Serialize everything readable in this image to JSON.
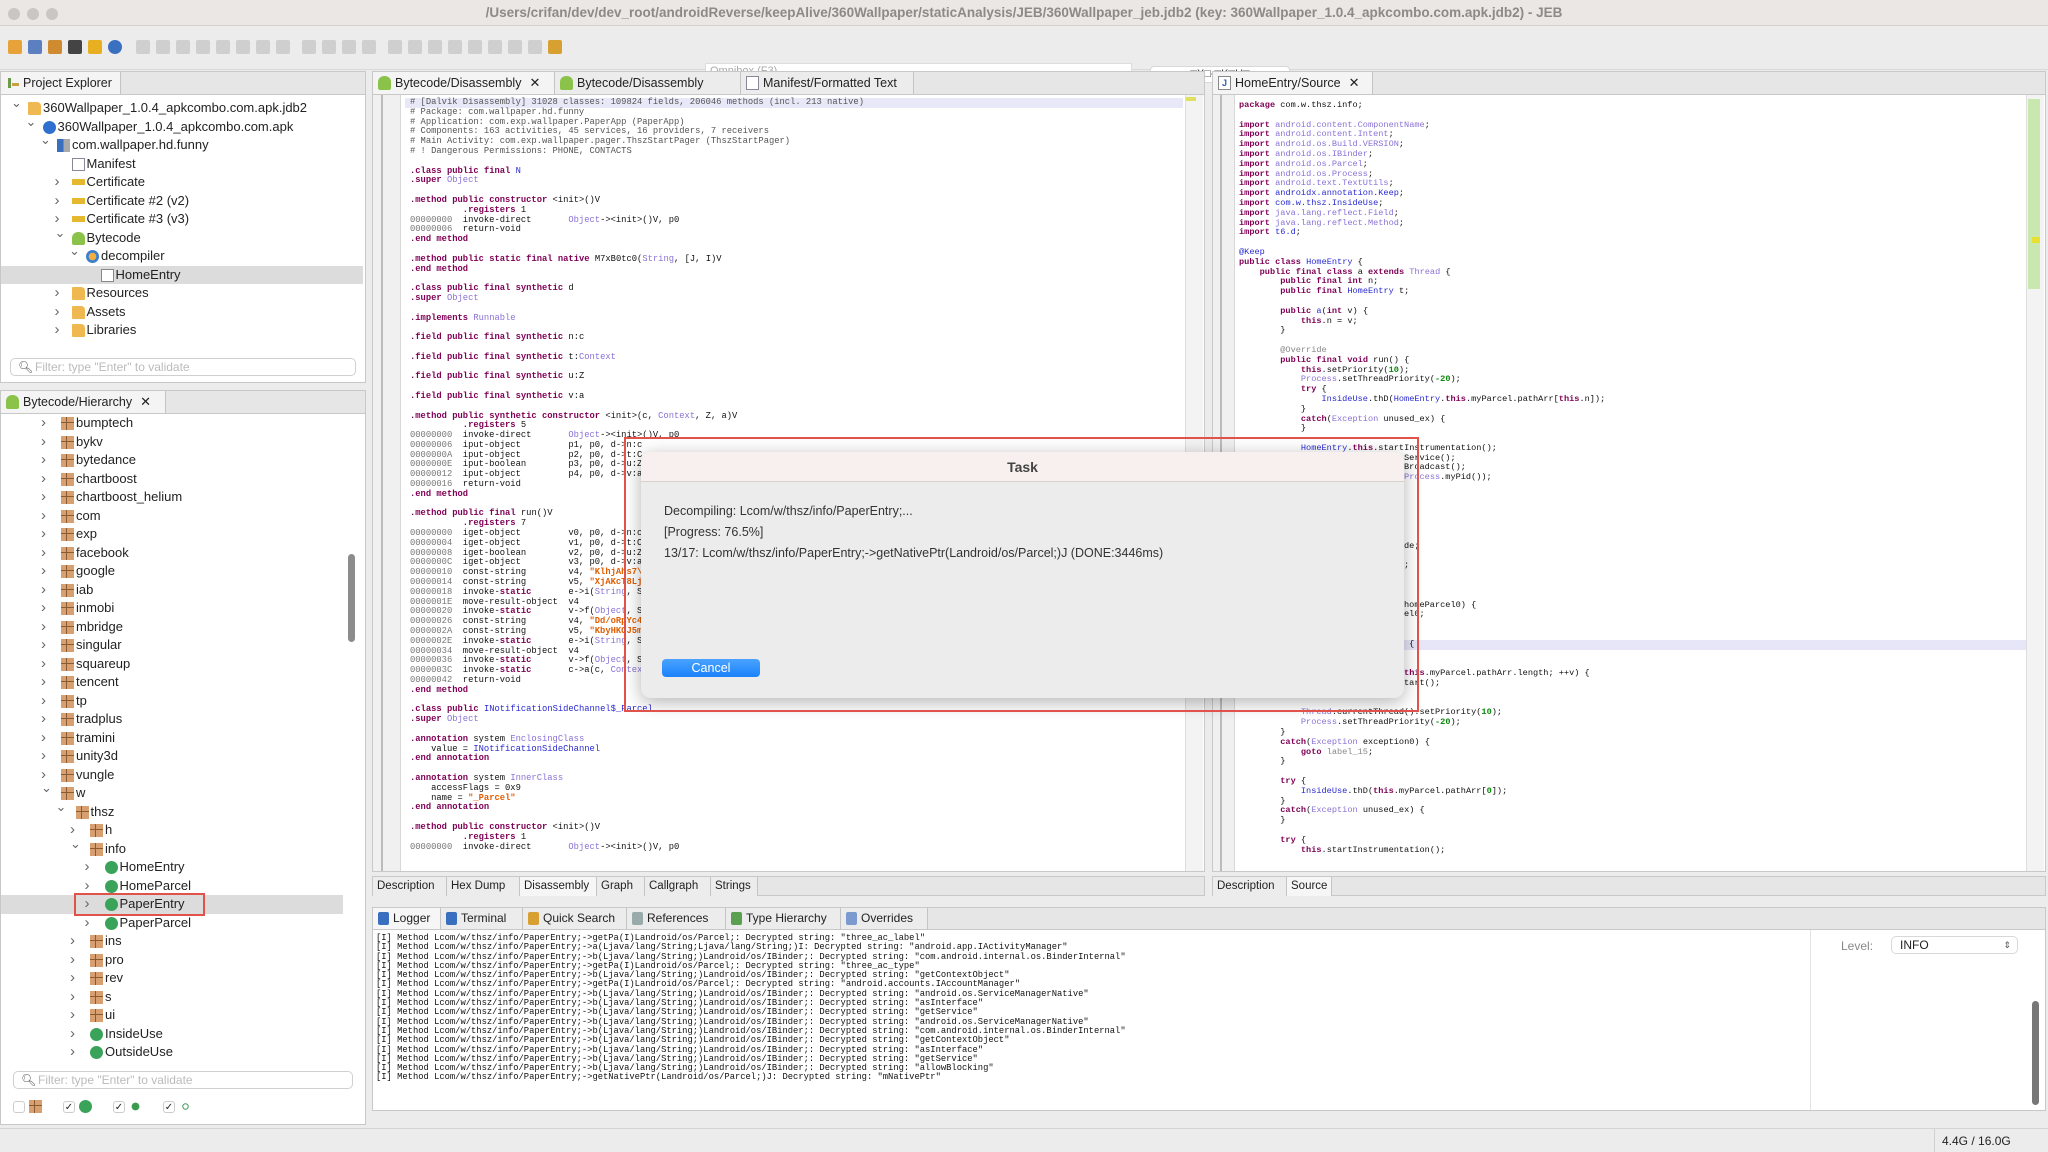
{
  "window": {
    "title": "/Users/crifan/dev/dev_root/androidReverse/keepAlive/360Wallpaper/staticAnalysis/JEB/360Wallpaper_jeb.jdb2 (key: 360Wallpaper_1.0.4_apkcombo.com.apk.jdb2) - JEB"
  },
  "toolbar": {
    "icons": [
      "open-icon",
      "save-icon",
      "wrench-icon",
      "terminal-icon",
      "warning-icon",
      "globe-icon",
      "step-icon",
      "step-into-icon",
      "back-icon",
      "forward-icon",
      "refs-icon",
      "rename-icon",
      "comment-icon",
      "xref-icon",
      "grid-icon",
      "plugin-icon",
      "split-icon",
      "merge-icon",
      "run-icon",
      "play-icon",
      "pause-icon",
      "stop-icon",
      "step-over-icon",
      "step-out-icon",
      "detach-icon",
      "attach-icon",
      "pen-icon"
    ],
    "omnibox_placeholder": "Omnibox (F3) ...",
    "key_label": "□X□-□K□U□"
  },
  "project_explorer": {
    "tab_label": "Project Explorer",
    "items": [
      {
        "label": "360Wallpaper_1.0.4_apkcombo.com.apk.jdb2",
        "depth": 0,
        "state": "open",
        "icon": "folder"
      },
      {
        "label": "360Wallpaper_1.0.4_apkcombo.com.apk",
        "depth": 1,
        "state": "open",
        "icon": "apk"
      },
      {
        "label": "com.wallpaper.hd.funny",
        "depth": 2,
        "state": "open",
        "icon": "app"
      },
      {
        "label": "Manifest",
        "depth": 3,
        "state": "leaf",
        "icon": "xml"
      },
      {
        "label": "Certificate",
        "depth": 3,
        "state": "closed",
        "icon": "key"
      },
      {
        "label": "Certificate #2 (v2)",
        "depth": 3,
        "state": "closed",
        "icon": "key"
      },
      {
        "label": "Certificate #3 (v3)",
        "depth": 3,
        "state": "closed",
        "icon": "key"
      },
      {
        "label": "Bytecode",
        "depth": 3,
        "state": "open",
        "icon": "android"
      },
      {
        "label": "decompiler",
        "depth": 4,
        "state": "open",
        "icon": "decompiler"
      },
      {
        "label": "HomeEntry",
        "depth": 5,
        "state": "leaf",
        "icon": "java",
        "selected": true
      },
      {
        "label": "Resources",
        "depth": 3,
        "state": "closed",
        "icon": "folder"
      },
      {
        "label": "Assets",
        "depth": 3,
        "state": "closed",
        "icon": "folder"
      },
      {
        "label": "Libraries",
        "depth": 3,
        "state": "closed",
        "icon": "folder"
      }
    ],
    "filter_placeholder": "Filter: type \"Enter\" to validate"
  },
  "hierarchy": {
    "tab_label": "Bytecode/Hierarchy",
    "items": [
      {
        "label": "bumptech",
        "depth": 0,
        "state": "closed",
        "icon": "pkg"
      },
      {
        "label": "bykv",
        "depth": 0,
        "state": "closed",
        "icon": "pkg"
      },
      {
        "label": "bytedance",
        "depth": 0,
        "state": "closed",
        "icon": "pkg"
      },
      {
        "label": "chartboost",
        "depth": 0,
        "state": "closed",
        "icon": "pkg"
      },
      {
        "label": "chartboost_helium",
        "depth": 0,
        "state": "closed",
        "icon": "pkg"
      },
      {
        "label": "com",
        "depth": 0,
        "state": "closed",
        "icon": "pkg"
      },
      {
        "label": "exp",
        "depth": 0,
        "state": "closed",
        "icon": "pkg"
      },
      {
        "label": "facebook",
        "depth": 0,
        "state": "closed",
        "icon": "pkg"
      },
      {
        "label": "google",
        "depth": 0,
        "state": "closed",
        "icon": "pkg"
      },
      {
        "label": "iab",
        "depth": 0,
        "state": "closed",
        "icon": "pkg"
      },
      {
        "label": "inmobi",
        "depth": 0,
        "state": "closed",
        "icon": "pkg"
      },
      {
        "label": "mbridge",
        "depth": 0,
        "state": "closed",
        "icon": "pkg"
      },
      {
        "label": "singular",
        "depth": 0,
        "state": "closed",
        "icon": "pkg"
      },
      {
        "label": "squareup",
        "depth": 0,
        "state": "closed",
        "icon": "pkg"
      },
      {
        "label": "tencent",
        "depth": 0,
        "state": "closed",
        "icon": "pkg"
      },
      {
        "label": "tp",
        "depth": 0,
        "state": "closed",
        "icon": "pkg"
      },
      {
        "label": "tradplus",
        "depth": 0,
        "state": "closed",
        "icon": "pkg"
      },
      {
        "label": "tramini",
        "depth": 0,
        "state": "closed",
        "icon": "pkg"
      },
      {
        "label": "unity3d",
        "depth": 0,
        "state": "closed",
        "icon": "pkg"
      },
      {
        "label": "vungle",
        "depth": 0,
        "state": "closed",
        "icon": "pkg"
      },
      {
        "label": "w",
        "depth": 0,
        "state": "open",
        "icon": "pkg"
      },
      {
        "label": "thsz",
        "depth": 1,
        "state": "open",
        "icon": "pkg"
      },
      {
        "label": "h",
        "depth": 2,
        "state": "closed",
        "icon": "pkg"
      },
      {
        "label": "info",
        "depth": 2,
        "state": "open",
        "icon": "pkg"
      },
      {
        "label": "HomeEntry",
        "depth": 3,
        "state": "closed",
        "icon": "class"
      },
      {
        "label": "HomeParcel",
        "depth": 3,
        "state": "closed",
        "icon": "class"
      },
      {
        "label": "PaperEntry",
        "depth": 3,
        "state": "closed",
        "icon": "class",
        "selected": true,
        "highlighted": true
      },
      {
        "label": "PaperParcel",
        "depth": 3,
        "state": "closed",
        "icon": "class"
      },
      {
        "label": "ins",
        "depth": 2,
        "state": "closed",
        "icon": "pkg"
      },
      {
        "label": "pro",
        "depth": 2,
        "state": "closed",
        "icon": "pkg"
      },
      {
        "label": "rev",
        "depth": 2,
        "state": "closed",
        "icon": "pkg"
      },
      {
        "label": "s",
        "depth": 2,
        "state": "closed",
        "icon": "pkg"
      },
      {
        "label": "ui",
        "depth": 2,
        "state": "closed",
        "icon": "pkg"
      },
      {
        "label": "InsideUse",
        "depth": 2,
        "state": "closed",
        "icon": "class"
      },
      {
        "label": "OutsideUse",
        "depth": 2,
        "state": "closed",
        "icon": "class"
      }
    ],
    "filter_placeholder": "Filter: type \"Enter\" to validate",
    "toggles": [
      {
        "icon": "package-icon",
        "checked": false
      },
      {
        "icon": "class-icon",
        "checked": true
      },
      {
        "icon": "method-icon",
        "checked": true
      },
      {
        "icon": "field-icon",
        "checked": true
      }
    ]
  },
  "editor_tabs": [
    {
      "label": "Bytecode/Disassembly",
      "icon": "android",
      "closable": true,
      "active": true
    },
    {
      "label": "Bytecode/Disassembly",
      "icon": "android",
      "closable": false
    },
    {
      "label": "Manifest/Formatted Text",
      "icon": "xml",
      "closable": false
    }
  ],
  "disassembly": {
    "lines": [
      "# [Dalvik Disassembly] 31028 classes: 109824 fields, 206046 methods (incl. 213 native)",
      "# Package: com.wallpaper.hd.funny",
      "# Application: com.exp.wallpaper.PaperApp (PaperApp)",
      "# Components: 163 activities, 45 services, 16 providers, 7 receivers",
      "# Main Activity: com.exp.wallpaper.pager.ThszStartPager (ThszStartPager)",
      "# ! Dangerous Permissions: PHONE, CONTACTS",
      "",
      ".class public final N",
      ".super Object",
      "",
      ".method public constructor <init>()V",
      "          .registers 1",
      "00000000  invoke-direct       Object-><init>()V, p0",
      "00000006  return-void",
      ".end method",
      "",
      ".method public static final native M7xB0tc0(String, [J, I)V",
      ".end method",
      "",
      ".class public final synthetic d",
      ".super Object",
      "",
      ".implements Runnable",
      "",
      ".field public final synthetic n:c",
      "",
      ".field public final synthetic t:Context",
      "",
      ".field public final synthetic u:Z",
      "",
      ".field public final synthetic v:a",
      "",
      ".method public synthetic constructor <init>(c, Context, Z, a)V",
      "          .registers 5",
      "00000000  invoke-direct       Object-><init>()V, p0",
      "00000006  iput-object         p1, p0, d->n:c",
      "0000000A  iput-object         p2, p0, d->t:C",
      "0000000E  iput-boolean        p3, p0, d->u:Z",
      "00000012  iput-object         p4, p0, d->v:a",
      "00000016  return-void",
      ".end method",
      "",
      ".method public final run()V",
      "          .registers 7",
      "00000000  iget-object         v0, p0, d->n:c",
      "00000004  iget-object         v1, p0, d->t:C",
      "00000008  iget-boolean        v2, p0, d->u:Z",
      "0000000C  iget-object         v3, p0, d->v:a",
      "00000010  const-string        v4, \"KlhjAhs7\\",
      "00000014  const-string        v5, \"XjAKcT8Lj",
      "00000018  invoke-static       e->i(String, S",
      "0000001E  move-result-object  v4",
      "00000020  invoke-static       v->f(Object, S",
      "00000026  const-string        v4, \"Dd/oRpYc4",
      "0000002A  const-string        v5, \"KbyHKOJ5m",
      "0000002E  invoke-static       e->i(String, S",
      "00000034  move-result-object  v4",
      "00000036  invoke-static       v->f(Object, S",
      "0000003C  invoke-static       c->a(c, Contex",
      "00000042  return-void",
      ".end method",
      "",
      ".class public INotificationSideChannel$_Parcel",
      ".super Object",
      "",
      ".annotation system EnclosingClass",
      "    value = INotificationSideChannel",
      ".end annotation",
      "",
      ".annotation system InnerClass",
      "    accessFlags = 0x9",
      "    name = \"_Parcel\"",
      ".end annotation",
      "",
      ".method public constructor <init>()V",
      "          .registers 1",
      "00000000  invoke-direct       Object-><init>()V, p0"
    ],
    "bottom_tabs": [
      "Description",
      "Hex Dump",
      "Disassembly",
      "Graph",
      "Callgraph",
      "Strings"
    ],
    "active_bottom_tab": 2
  },
  "source": {
    "tab_label": "HomeEntry/Source",
    "lines": [
      "package com.w.thsz.info;",
      "",
      "import android.content.ComponentName;",
      "import android.content.Intent;",
      "import android.os.Build.VERSION;",
      "import android.os.IBinder;",
      "import android.os.Parcel;",
      "import android.os.Process;",
      "import android.text.TextUtils;",
      "import androidx.annotation.Keep;",
      "import com.w.thsz.InsideUse;",
      "import java.lang.reflect.Field;",
      "import java.lang.reflect.Method;",
      "import t6.d;",
      "",
      "@Keep",
      "public class HomeEntry {",
      "    public final class a extends Thread {",
      "        public final int n;",
      "        public final HomeEntry t;",
      "",
      "        public a(int v) {",
      "            this.n = v;",
      "        }",
      "",
      "        @Override",
      "        public final void run() {",
      "            this.setPriority(10);",
      "            Process.setThreadPriority(-20);",
      "            try {",
      "                InsideUse.thD(HomeEntry.this.myParcel.pathArr[this.n]);",
      "            }",
      "            catch(Exception unused_ex) {",
      "            }",
      "",
      "            HomeEntry.this.startInstrumentation();",
      "                                Service();",
      "                                Broadcast();",
      "                                Process.myPid());",
      "",
      "",
      "",
      "",
      "",
      "",
      "                                de;",
      "",
      "                                ;",
      "",
      "",
      "",
      "                                homeParcel0) {",
      "                                el0;",
      "",
      "",
      "                                 {",
      "",
      "",
      "                                this.myParcel.pathArr.length; ++v) {",
      "                                tart();",
      "",
      "",
      "            Thread.currentThread().setPriority(10);",
      "            Process.setThreadPriority(-20);",
      "        }",
      "        catch(Exception exception0) {",
      "            goto label_15;",
      "        }",
      "",
      "        try {",
      "            InsideUse.thD(this.myParcel.pathArr[0]);",
      "        }",
      "        catch(Exception unused_ex) {",
      "        }",
      "",
      "        try {",
      "            this.startInstrumentation();"
    ],
    "highlight_line": 55,
    "bottom_tabs": [
      "Description",
      "Source"
    ],
    "active_bottom_tab": 1
  },
  "console": {
    "tabs": [
      {
        "label": "Logger",
        "icon": "logger",
        "active": true
      },
      {
        "label": "Terminal",
        "icon": "terminal"
      },
      {
        "label": "Quick Search",
        "icon": "quick-search"
      },
      {
        "label": "References",
        "icon": "references"
      },
      {
        "label": "Type Hierarchy",
        "icon": "type-hierarchy"
      },
      {
        "label": "Overrides",
        "icon": "overrides"
      }
    ],
    "level_label": "Level:",
    "level_value": "INFO",
    "log_lines": [
      "[I] Method Lcom/w/thsz/info/PaperEntry;->getPa(I)Landroid/os/Parcel;: Decrypted string: \"three_ac_label\"",
      "[I] Method Lcom/w/thsz/info/PaperEntry;->a(Ljava/lang/String;Ljava/lang/String;)I: Decrypted string: \"android.app.IActivityManager\"",
      "[I] Method Lcom/w/thsz/info/PaperEntry;->b(Ljava/lang/String;)Landroid/os/IBinder;: Decrypted string: \"com.android.internal.os.BinderInternal\"",
      "[I] Method Lcom/w/thsz/info/PaperEntry;->getPa(I)Landroid/os/Parcel;: Decrypted string: \"three_ac_type\"",
      "[I] Method Lcom/w/thsz/info/PaperEntry;->b(Ljava/lang/String;)Landroid/os/IBinder;: Decrypted string: \"getContextObject\"",
      "[I] Method Lcom/w/thsz/info/PaperEntry;->getPa(I)Landroid/os/Parcel;: Decrypted string: \"android.accounts.IAccountManager\"",
      "[I] Method Lcom/w/thsz/info/PaperEntry;->b(Ljava/lang/String;)Landroid/os/IBinder;: Decrypted string: \"android.os.ServiceManagerNative\"",
      "[I] Method Lcom/w/thsz/info/PaperEntry;->b(Ljava/lang/String;)Landroid/os/IBinder;: Decrypted string: \"asInterface\"",
      "[I] Method Lcom/w/thsz/info/PaperEntry;->b(Ljava/lang/String;)Landroid/os/IBinder;: Decrypted string: \"getService\"",
      "[I] Method Lcom/w/thsz/info/PaperEntry;->b(Ljava/lang/String;)Landroid/os/IBinder;: Decrypted string: \"android.os.ServiceManagerNative\"",
      "[I] Method Lcom/w/thsz/info/PaperEntry;->b(Ljava/lang/String;)Landroid/os/IBinder;: Decrypted string: \"com.android.internal.os.BinderInternal\"",
      "[I] Method Lcom/w/thsz/info/PaperEntry;->b(Ljava/lang/String;)Landroid/os/IBinder;: Decrypted string: \"getContextObject\"",
      "[I] Method Lcom/w/thsz/info/PaperEntry;->b(Ljava/lang/String;)Landroid/os/IBinder;: Decrypted string: \"asInterface\"",
      "[I] Method Lcom/w/thsz/info/PaperEntry;->b(Ljava/lang/String;)Landroid/os/IBinder;: Decrypted string: \"getService\"",
      "[I] Method Lcom/w/thsz/info/PaperEntry;->b(Ljava/lang/String;)Landroid/os/IBinder;: Decrypted string: \"allowBlocking\"",
      "[I] Method Lcom/w/thsz/info/PaperEntry;->getNativePtr(Landroid/os/Parcel;)J: Decrypted string: \"mNativePtr\""
    ]
  },
  "status": {
    "memory": "4.4G / 16.0G"
  },
  "dialog": {
    "title": "Task",
    "line1": "Decompiling: Lcom/w/thsz/info/PaperEntry;...",
    "progress_text": "[Progress: 76.5%]",
    "progress": 76.5,
    "line3": "13/17: Lcom/w/thsz/info/PaperEntry;->getNativePtr(Landroid/os/Parcel;)J (DONE:3446ms)",
    "cancel_label": "Cancel"
  },
  "colors": {
    "annotation_box": "#e0524a",
    "accent_button": "#1a82fb",
    "keyword": "#7f0055",
    "string": "#e25d00",
    "type": "#8a72d6"
  }
}
